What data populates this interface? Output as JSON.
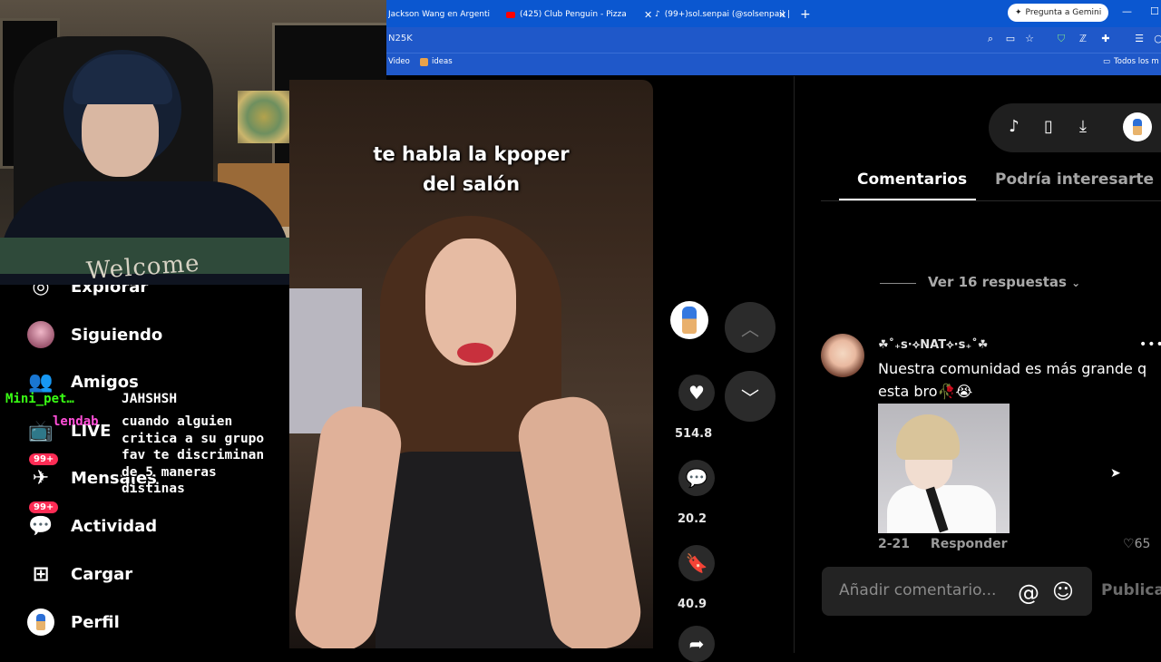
{
  "browser": {
    "tabs": [
      {
        "label": "Jackson Wang en Argenti"
      },
      {
        "label": "(425) Club Penguin - Pizza"
      },
      {
        "label": "(99+)sol.senpai (@solsenpai) |"
      }
    ],
    "new_tab": "+",
    "gemini_label": "Pregunta a Gemini",
    "url_fragment": "N25K",
    "bookmarks": [
      {
        "label": "Video"
      },
      {
        "label": "ideas"
      }
    ],
    "all_bookmarks": "Todos los m",
    "accent_color": "#0b57d0"
  },
  "webcam": {
    "sweater_text": "Welcome"
  },
  "sidebar": {
    "items": [
      {
        "label": "Explorar",
        "icon": "compass-icon"
      },
      {
        "label": "Siguiendo",
        "icon": "avatar"
      },
      {
        "label": "Amigos",
        "icon": "friends-icon"
      },
      {
        "label": "LIVE",
        "icon": "live-icon"
      },
      {
        "label": "Mensajes",
        "icon": "inbox-icon",
        "badge": "99+"
      },
      {
        "label": "Actividad",
        "icon": "activity-icon",
        "badge": "99+"
      },
      {
        "label": "Cargar",
        "icon": "upload-icon"
      },
      {
        "label": "Perfil",
        "icon": "profile-avatar"
      }
    ]
  },
  "chat": {
    "messages": [
      {
        "user": "Mini_pet…",
        "user_color": "#39ff14",
        "text": "JAHSHSH"
      },
      {
        "user": "lendab",
        "user_color": "#ff4fd8",
        "text": "cuando alguien critica a su grupo fav te discriminan de 5 maneras distinas"
      }
    ]
  },
  "video": {
    "caption_line1": "te habla la kpoper",
    "caption_line2": "del salón"
  },
  "actions": {
    "likes": "514.8",
    "comments": "20.2",
    "saves": "40.9"
  },
  "panel": {
    "tabs": [
      {
        "label": "Comentarios",
        "active": true
      },
      {
        "label": "Podría interesarte",
        "active": false
      }
    ],
    "view_replies": "Ver 16 respuestas",
    "comment": {
      "user": "☘˚₊ꜱ·⟡NAT⟡·ꜱ₊˚☘",
      "text": "Nuestra comunidad es más grande q esta bro🥀😭",
      "date": "2-21",
      "reply": "Responder",
      "likes": "65"
    },
    "input_placeholder": "Añadir comentario...",
    "publish": "Publicar",
    "colors": {
      "badge": "#fe2c55",
      "background": "#000000"
    }
  }
}
